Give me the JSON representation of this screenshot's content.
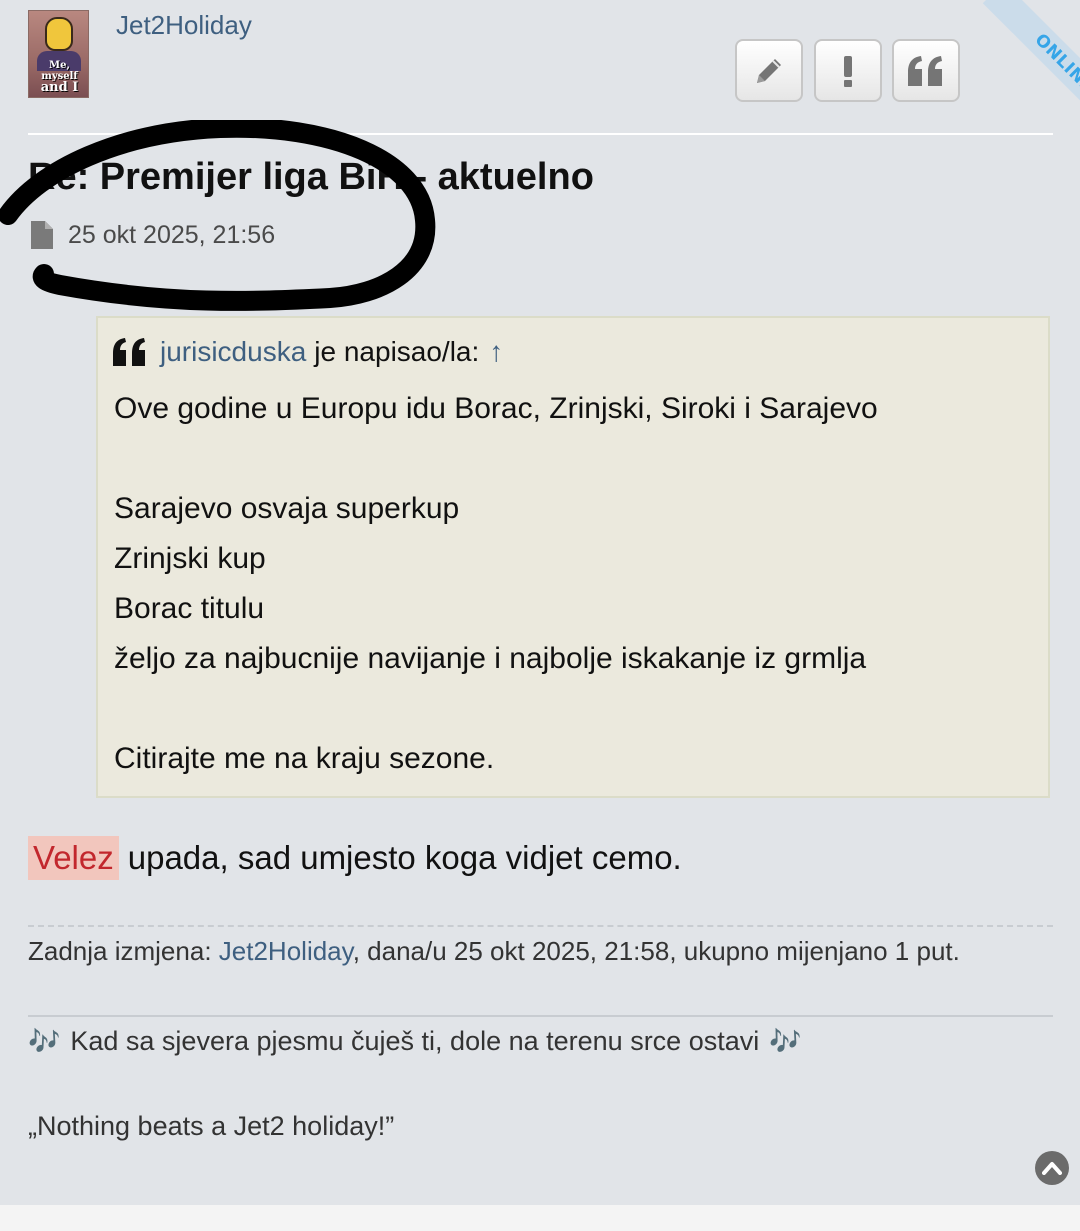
{
  "post": {
    "author": "Jet2Holiday",
    "avatar_caption_line1": "Me, myself",
    "avatar_caption_line2": "and I",
    "online_badge": "ONLINE",
    "title": "Re: Premijer liga BiH - aktuelno",
    "date": "25 okt 2025, 21:56",
    "buttons": {
      "edit_icon": "pencil-icon",
      "report_icon": "exclamation-icon",
      "quote_icon": "quote-icon"
    }
  },
  "quote": {
    "author": "jurisicduska",
    "said": "je napisao/la:",
    "up_arrow": "↑",
    "lines": [
      "Ove godine u Europu idu Borac, Zrinjski, Siroki i Sarajevo",
      "",
      "Sarajevo osvaja superkup",
      "Zrinjski kup",
      "Borac titulu",
      "željo za najbucnije navijanje i najbolje iskakanje iz grmlja",
      "",
      "Citirajte me na kraju sezone."
    ]
  },
  "reply": {
    "highlighted": "Velez",
    "rest": "upada, sad umjesto koga vidjet cemo."
  },
  "edit_note": {
    "prefix": "Zadnja izmjena:",
    "user": "Jet2Holiday",
    "suffix": ", dana/u 25 okt 2025, 21:58, ukupno mijenjano 1 put."
  },
  "signature": {
    "line1": "Kad sa sjevera pjesmu čuješ ti, dole na terenu srce ostavi",
    "notes": "🎶",
    "line2": "„Nothing beats a Jet2 holiday!”"
  },
  "colors": {
    "link": "#3e5f80",
    "highlight_bg": "#f2c6bd",
    "highlight_text": "#c2272d",
    "quote_bg": "#ebe9dd",
    "online": "#36a5e8"
  }
}
